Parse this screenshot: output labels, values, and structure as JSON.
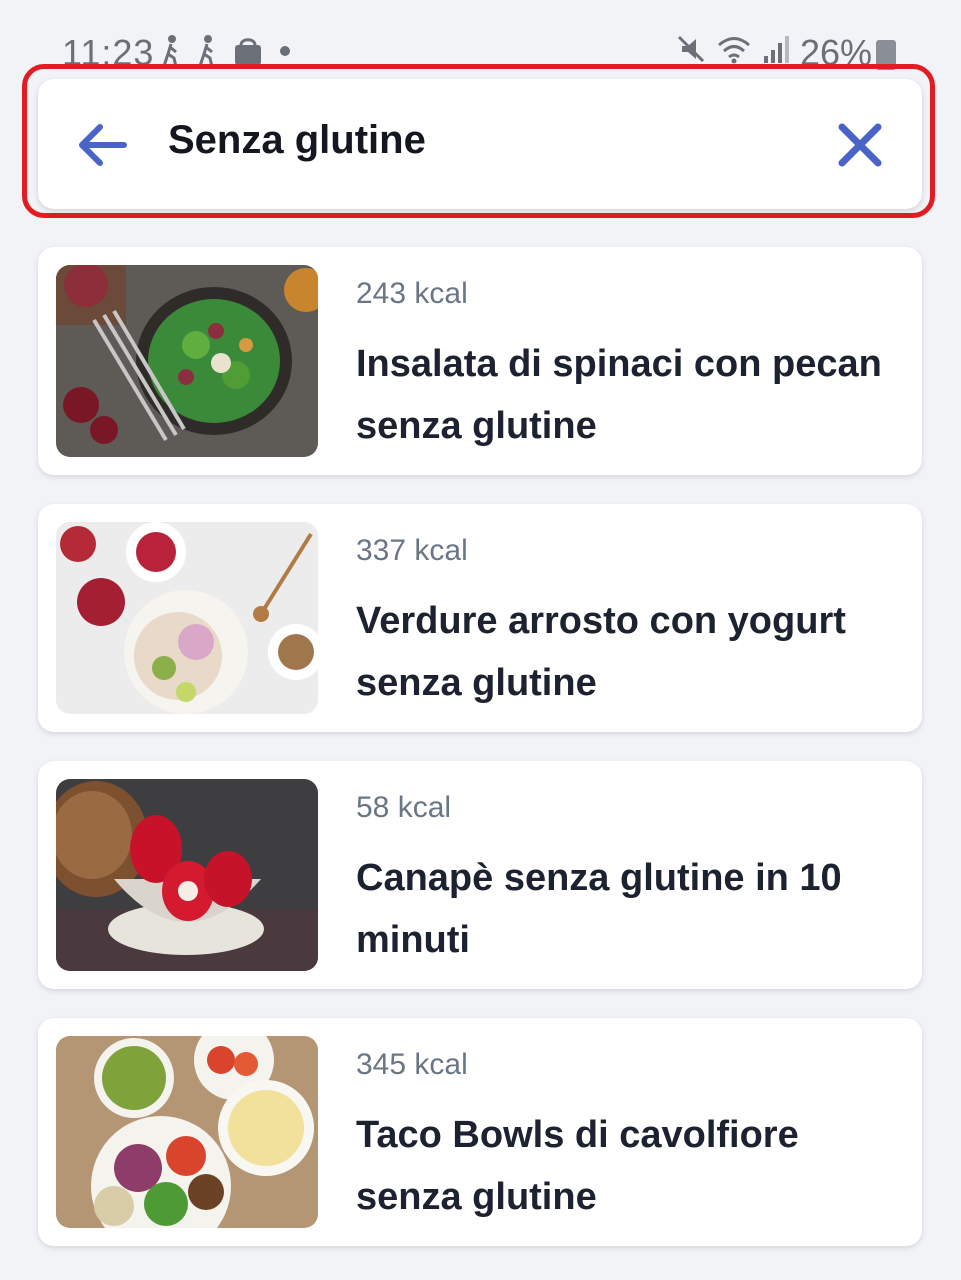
{
  "status_bar": {
    "time": "11:23",
    "battery": "26%",
    "icons_left": [
      "walking-icon",
      "walking-icon",
      "shopping-bag-icon",
      "dot-icon"
    ],
    "icons_right": [
      "mute-icon",
      "wifi-icon",
      "signal-icon",
      "battery-icon"
    ]
  },
  "search": {
    "query": "Senza glutine",
    "back_icon": "arrow-left-icon",
    "clear_icon": "close-icon",
    "accent_color": "#4a63c9",
    "highlight_color": "#e31b23"
  },
  "results": [
    {
      "kcal": "243 kcal",
      "title": "Insalata di spinaci con pecan senza glutine"
    },
    {
      "kcal": "337 kcal",
      "title": "Verdure arrosto con yogurt senza glutine"
    },
    {
      "kcal": "58 kcal",
      "title": "Canapè senza glutine in 10 minuti"
    },
    {
      "kcal": "345 kcal",
      "title": "Taco Bowls di cavolfiore senza glutine"
    }
  ]
}
